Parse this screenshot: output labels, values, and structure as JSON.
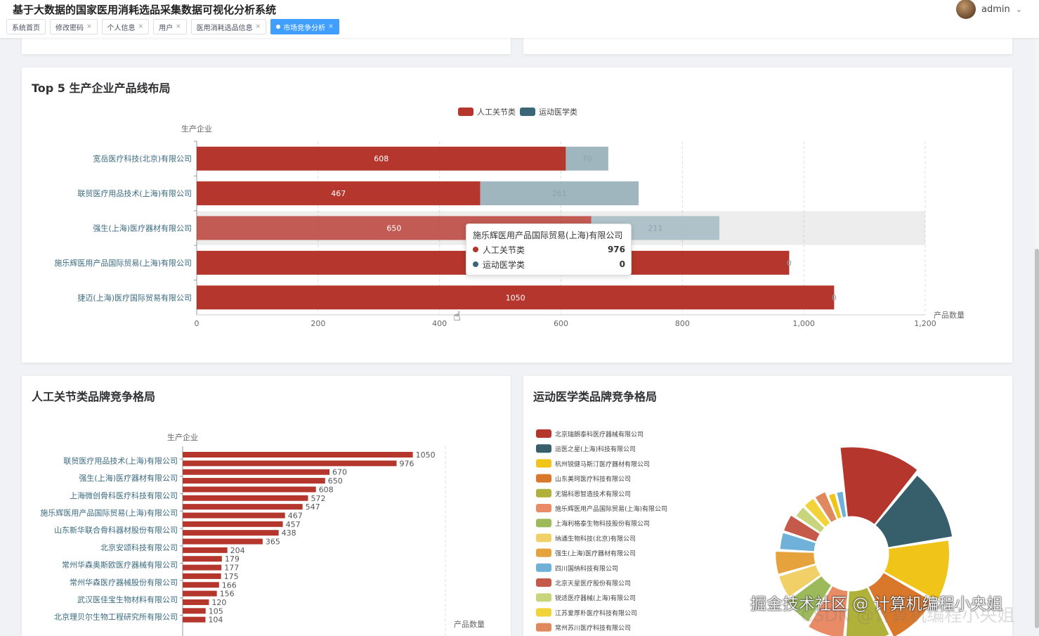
{
  "app": {
    "title": "基于大数据的国家医用消耗选品采集数据可视化分析系统",
    "user": "admin",
    "tabs": [
      {
        "label": "系统首页",
        "closable": false,
        "active": false
      },
      {
        "label": "修改密码",
        "closable": true,
        "active": false
      },
      {
        "label": "个人信息",
        "closable": true,
        "active": false
      },
      {
        "label": "用户",
        "closable": true,
        "active": false
      },
      {
        "label": "医用消耗选品信息",
        "closable": true,
        "active": false
      },
      {
        "label": "市场竞争分析",
        "closable": true,
        "active": true
      }
    ],
    "close_symbol": "×"
  },
  "card_top5": {
    "title": "Top 5 生产企业产品线布局"
  },
  "card_joint": {
    "title": "人工关节类品牌竞争格局"
  },
  "card_sports": {
    "title": "运动医学类品牌竞争格局"
  },
  "tooltip": {
    "title": "施乐辉医用产品国际贸易(上海)有限公司",
    "rows": [
      {
        "label": "人工关节类",
        "value": "976",
        "color": "#b5362c"
      },
      {
        "label": "运动医学类",
        "value": "0",
        "color": "#3a6777"
      }
    ]
  },
  "watermark": {
    "text": "掘金技术社区 @ 计算机编程小央姐",
    "text2": "CSDN @计算机编程小央姐"
  },
  "chart_data": [
    {
      "type": "bar",
      "orientation": "horizontal",
      "stacked": true,
      "title": "Top 5 生产企业产品线布局",
      "ylabel": "生产企业",
      "xlabel": "产品数量",
      "xlim": [
        0,
        1200
      ],
      "xticks": [
        "0",
        "200",
        "400",
        "600",
        "800",
        "1,000",
        "1,200"
      ],
      "legend_position": "top-center",
      "categories": [
        "宽岳医疗科技(北京)有限公司",
        "联贸医疗用品技术(上海)有限公司",
        "强生(上海)医疗器材有限公司",
        "施乐辉医用产品国际贸易(上海)有限公司",
        "捷迈(上海)医疗国际贸易有限公司"
      ],
      "series": [
        {
          "name": "人工关节类",
          "color": "#b5362c",
          "values": [
            608,
            467,
            650,
            976,
            1050
          ]
        },
        {
          "name": "运动医学类",
          "color": "#9fb6bf",
          "legend_color": "#3a6777",
          "values": [
            70,
            261,
            211,
            0,
            0
          ]
        }
      ],
      "data_labels": [
        [
          "608",
          "70"
        ],
        [
          "467",
          "261"
        ],
        [
          "650",
          "211"
        ],
        [
          "976",
          "0"
        ],
        [
          "1050",
          "0"
        ]
      ],
      "highlighted_category": "强生(上海)医疗器材有限公司"
    },
    {
      "type": "bar",
      "orientation": "horizontal",
      "title": "人工关节类品牌竞争格局",
      "ylabel": "生产企业",
      "xlabel": "产品数量",
      "color": "#b5362c",
      "values": [
        1050,
        976,
        670,
        650,
        608,
        572,
        547,
        467,
        457,
        438,
        365,
        204,
        179,
        177,
        175,
        166,
        156,
        120,
        105,
        104
      ],
      "category_labels": [
        "联贸医疗用品技术(上海)有限公司",
        "强生(上海)医疗器材有限公司",
        "上海微创骨科医疗科技有限公司",
        "施乐辉医用产品国际贸易(上海)有限公司",
        "山东新华联合骨科器材股份有限公司",
        "北京安颂科技有限公司",
        "常州华森奥斯欧医疗器械有限公司",
        "常州华森医疗器械股份有限公司",
        "武汉医佳宝生物材料有限公司",
        "北京理贝尔生物工程研究所有限公司"
      ]
    },
    {
      "type": "pie",
      "variant": "rose",
      "title": "运动医学类品牌竞争格局",
      "legend_position": "left",
      "labels": [
        "北京瑞朗泰科医疗器械有限公司",
        "运医之星(上海)科技有限公司",
        "杭州锐健马斯汀医疗器材有限公司",
        "山东美珂医疗科技有限公司",
        "无锡科恩智造技术有限公司",
        "施乐辉医用产品国际贸易(上海)有限公司",
        "上海利格泰生物科技股份有限公司",
        "纳通生物科技(北京)有限公司",
        "强生(上海)医疗器材有限公司",
        "四川国纳科技有限公司",
        "北京天星医疗股份有限公司",
        "锐适医疗器械(上海)有限公司",
        "江苏爱厚朴医疗科技有限公司",
        "常州苏川医疗科技有限公司"
      ],
      "colors": [
        "#b5362c",
        "#375f6b",
        "#f0c419",
        "#d9772b",
        "#b0b13a",
        "#e98b66",
        "#9cba5a",
        "#f0d067",
        "#e6a23c",
        "#6fb1d8",
        "#c65a4a",
        "#c9d57d",
        "#f2d33a",
        "#e0895e"
      ],
      "values": [
        12,
        11,
        10,
        9,
        8,
        7,
        6,
        5,
        5,
        4,
        4,
        3,
        3,
        3,
        2,
        2
      ]
    }
  ]
}
